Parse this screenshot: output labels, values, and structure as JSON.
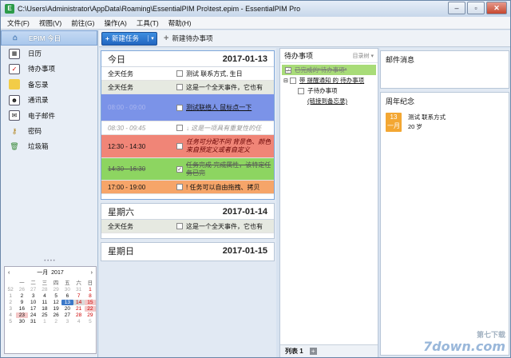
{
  "window": {
    "title": "C:\\Users\\Administrator\\AppData\\Roaming\\EssentialPIM Pro\\test.epim - EssentialPIM Pro"
  },
  "menu": [
    "文件(F)",
    "视图(V)",
    "前往(G)",
    "操作(A)",
    "工具(T)",
    "帮助(H)"
  ],
  "sidebar": {
    "items": [
      {
        "label": "EPIM 今日",
        "icon": "home-icon"
      },
      {
        "label": "日历",
        "icon": "calendar-icon"
      },
      {
        "label": "待办事项",
        "icon": "todo-icon"
      },
      {
        "label": "备忘录",
        "icon": "notes-icon"
      },
      {
        "label": "通讯录",
        "icon": "contacts-icon"
      },
      {
        "label": "电子邮件",
        "icon": "email-icon"
      },
      {
        "label": "密码",
        "icon": "password-icon"
      },
      {
        "label": "垃圾箱",
        "icon": "trash-icon"
      }
    ]
  },
  "mini_calendar": {
    "month": "一月",
    "year": "2017",
    "weekday_headers": [
      "",
      "一",
      "二",
      "三",
      "四",
      "五",
      "六",
      "日"
    ],
    "rows": [
      [
        "52",
        "26",
        "27",
        "28",
        "29",
        "30",
        "31",
        "1"
      ],
      [
        "1",
        "2",
        "3",
        "4",
        "5",
        "6",
        "7",
        "8"
      ],
      [
        "2",
        "9",
        "10",
        "11",
        "12",
        "13",
        "14",
        "15"
      ],
      [
        "3",
        "16",
        "17",
        "18",
        "19",
        "20",
        "21",
        "22"
      ],
      [
        "4",
        "23",
        "24",
        "25",
        "26",
        "27",
        "28",
        "29"
      ],
      [
        "5",
        "30",
        "31",
        "1",
        "2",
        "3",
        "4",
        "5"
      ]
    ]
  },
  "toolbar": {
    "new_task": "新建任务",
    "new_todo": "新建待办事项"
  },
  "calendar": {
    "day1": {
      "label": "今日",
      "date": "2017-01-13",
      "events": [
        {
          "time": "全天任务",
          "text": "测试 联系方式, 生日"
        },
        {
          "time": "全天任务",
          "text": "这是一个全天事件，它也有"
        },
        {
          "time": "08:00 - 09:00",
          "text": "测试联络人 鼠标点一下"
        },
        {
          "time": "08:30 - 09:45",
          "text": "↓ 这是一项具有重复性的任"
        },
        {
          "time": "12:30 - 14:30",
          "text": "任务可分配不同 背景色、颜色来自预定义或者自定义"
        },
        {
          "time": "14:30 - 16:30",
          "text": "任务完成 完成属性，该特定任务已完"
        },
        {
          "time": "17:00 - 19:00",
          "text": "! 任务可以自由拖拽、拷贝"
        }
      ]
    },
    "day2": {
      "label": "星期六",
      "date": "2017-01-14",
      "events": [
        {
          "time": "全天任务",
          "text": "这是一个全天事件，它也有"
        }
      ]
    },
    "day3": {
      "label": "星期日",
      "date": "2017-01-15"
    }
  },
  "todo": {
    "title": "待办事项",
    "sort": "目录树 ▾",
    "items": [
      {
        "text": "已完成的\"待办事项\""
      },
      {
        "text": "带 提醒通知 的 待办事项"
      },
      {
        "text": "子待办事项"
      },
      {
        "text": "(链接到备忘录)"
      }
    ],
    "footer_tab": "列表 1"
  },
  "mail": {
    "title": "邮件消息"
  },
  "anniversary": {
    "title": "周年纪念",
    "day": "13",
    "month": "一月",
    "name": "测试 联系方式",
    "age": "20 岁"
  },
  "watermark": {
    "logo": "7down.com",
    "sub": "第七下载"
  },
  "colors": {
    "accent": "#2266c0",
    "event_blue": "#7b93e8",
    "event_red": "#f08577",
    "event_green": "#8dd561",
    "event_orange": "#f6a569",
    "event_gray": "#e6e9e1"
  }
}
